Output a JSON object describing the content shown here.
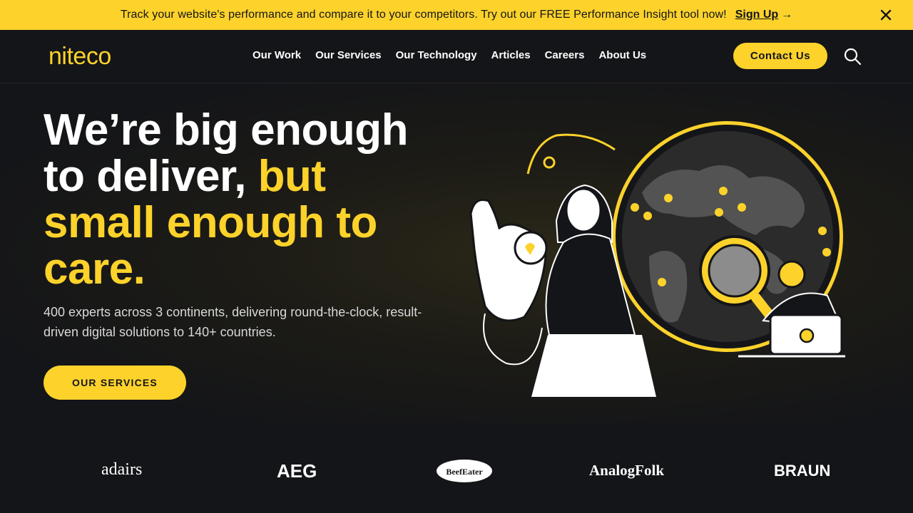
{
  "banner": {
    "message": "Track your website's performance and compare it to your competitors. Try out our FREE Performance Insight tool now!",
    "cta_label": "Sign Up",
    "cta_arrow": "→"
  },
  "header": {
    "logo_text": "niteco",
    "nav": [
      "Our Work",
      "Our Services",
      "Our Technology",
      "Articles",
      "Careers",
      "About Us"
    ],
    "contact_label": "Contact Us"
  },
  "hero": {
    "headline_white_1": "We’re big enough",
    "headline_white_2": "to deliver, ",
    "headline_yellow_1": "but",
    "headline_yellow_2": "small enough to",
    "headline_yellow_3": "care.",
    "subtitle": "400 experts across 3 continents, delivering round-the-clock, result-driven digital solutions to 140+ countries.",
    "cta_label": "OUR SERVICES"
  },
  "clients": {
    "logos": [
      "adairs",
      "AEG",
      "BeefEater",
      "AnalogFolk",
      "BRAUN"
    ]
  },
  "colors": {
    "brand_yellow": "#fcd22b",
    "background": "#141518"
  }
}
